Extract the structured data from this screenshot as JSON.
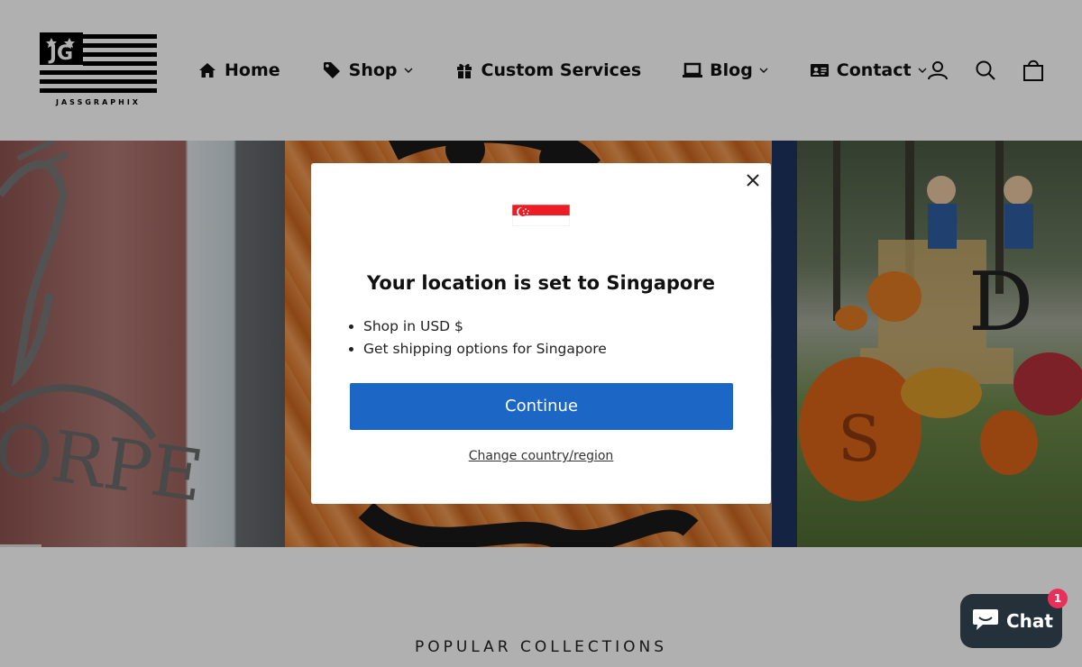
{
  "brand": {
    "logo_letters": "JG",
    "name": "JASSGRAPHIX"
  },
  "nav": {
    "items": [
      {
        "label": "Home",
        "icon": "home-icon",
        "has_dropdown": false
      },
      {
        "label": "Shop",
        "icon": "tag-icon",
        "has_dropdown": true
      },
      {
        "label": "Custom Services",
        "icon": "gift-icon",
        "has_dropdown": false
      },
      {
        "label": "Blog",
        "icon": "laptop-icon",
        "has_dropdown": true
      },
      {
        "label": "Contact",
        "icon": "id-card-icon",
        "has_dropdown": true
      }
    ]
  },
  "header_icons": [
    "account-icon",
    "search-icon",
    "cart-icon"
  ],
  "modal": {
    "title": "Your location is set to Singapore",
    "bullets": [
      "Shop in USD $",
      "Get shipping options for Singapore"
    ],
    "continue_label": "Continue",
    "change_label": "Change country/region",
    "flag_icon": "singapore-flag-icon"
  },
  "section": {
    "heading": "POPULAR COLLECTIONS"
  },
  "chat": {
    "label": "Chat",
    "badge": "1"
  },
  "colors": {
    "primary_button": "#1c67c6",
    "chat_bg": "#25313a",
    "badge": "#e8305b",
    "overlay": "rgba(0,0,0,0.31)"
  }
}
